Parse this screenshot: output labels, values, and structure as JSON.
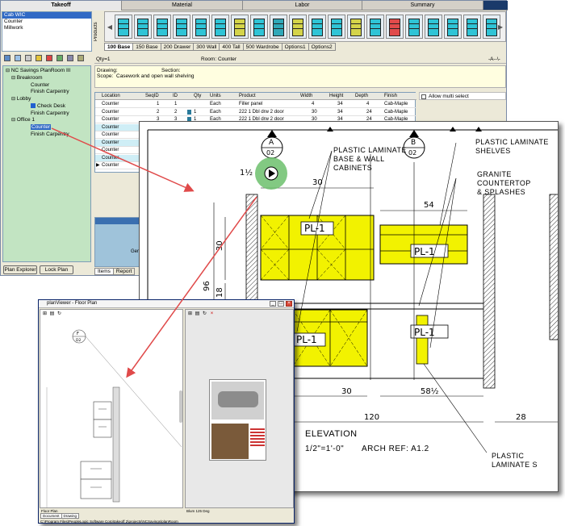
{
  "main": {
    "tabs": [
      "Takeoff",
      "Material",
      "Labor",
      "Summary"
    ],
    "categories": [
      "Cab WIC",
      "Counter",
      "Millwork"
    ],
    "products_label": "Products",
    "sub_tabs": [
      "100 Base",
      "150 Base",
      "200 Drawer",
      "300 Wall",
      "400 Tall",
      "500 Wardrobe",
      "Options1",
      "Options2"
    ],
    "qty_label": "Qty=1",
    "room_label": "Room: Counter",
    "nav_arrows": "-A--\\-",
    "drawing_label": "Drawing:",
    "section_label": "Section:",
    "scope_label": "Scope:",
    "scope_value": "Casework and open  wall shelving",
    "tree": {
      "root": "NC Savings  PlanRoom III",
      "items": [
        {
          "label": "Breakroom",
          "level": 1
        },
        {
          "label": "Counter",
          "level": 2
        },
        {
          "label": "Finish Carpentry",
          "level": 2
        },
        {
          "label": "Lobby",
          "level": 1
        },
        {
          "label": "Check Desk",
          "level": 2
        },
        {
          "label": "Finish Carpentry",
          "level": 2
        },
        {
          "label": "Office 1",
          "level": 1
        },
        {
          "label": "Counter",
          "level": 2
        },
        {
          "label": "Finish Carpentry",
          "level": 2
        }
      ]
    },
    "plan_explorer_btn": "Plan Explorer",
    "lock_plan_btn": "Lock Plan",
    "grid": {
      "headers": [
        "Location",
        "SeqID",
        "ID",
        "Qty",
        "Units",
        "Product",
        "Width",
        "Height",
        "Depth",
        "Finish"
      ],
      "rows": [
        {
          "location": "Counter",
          "seq": "1",
          "id": "1",
          "qty": "",
          "units": "Each",
          "product": "Filler panel",
          "width": "4",
          "height": "34",
          "depth": "4",
          "finish": "Cab-Maple"
        },
        {
          "location": "Counter",
          "seq": "2",
          "id": "2",
          "qty": "1",
          "units": "Each",
          "product": "222 1 Dbl drw 2 door",
          "width": "30",
          "height": "34",
          "depth": "24",
          "finish": "Cab-Maple"
        },
        {
          "location": "Counter",
          "seq": "3",
          "id": "3",
          "qty": "1",
          "units": "Each",
          "product": "222 1 Dbl drw 2 door",
          "width": "30",
          "height": "34",
          "depth": "24",
          "finish": "Cab-Maple"
        },
        {
          "location": "Counter",
          "seq": "",
          "id": "",
          "qty": "",
          "units": "",
          "product": "",
          "width": "",
          "height": "",
          "depth": "",
          "finish": ""
        },
        {
          "location": "Counter",
          "seq": "",
          "id": "",
          "qty": "",
          "units": "",
          "product": "",
          "width": "",
          "height": "",
          "depth": "",
          "finish": ""
        },
        {
          "location": "Counter",
          "seq": "",
          "id": "",
          "qty": "",
          "units": "",
          "product": "",
          "width": "",
          "height": "",
          "depth": "",
          "finish": ""
        },
        {
          "location": "Counter",
          "seq": "",
          "id": "",
          "qty": "",
          "units": "",
          "product": "",
          "width": "",
          "height": "",
          "depth": "",
          "finish": ""
        },
        {
          "location": "Counter",
          "seq": "",
          "id": "",
          "qty": "",
          "units": "",
          "product": "",
          "width": "",
          "height": "",
          "depth": "",
          "finish": ""
        },
        {
          "location": "Counter",
          "seq": "",
          "id": "",
          "qty": "",
          "units": "",
          "product": "",
          "width": "",
          "height": "",
          "depth": "",
          "finish": ""
        }
      ]
    },
    "allow_multi_select": "Allow multi select",
    "gen_label": "Gen",
    "items_tabs": [
      "Items",
      "Report"
    ]
  },
  "drawing": {
    "marker_a_letter": "A",
    "marker_a_num": "02",
    "marker_b_letter": "B",
    "marker_b_num": "02",
    "callout_base_wall": [
      "PLASTIC LAMINATE",
      "BASE & WALL",
      "CABINETS"
    ],
    "callout_shelves": [
      "PLASTIC LAMINATE",
      "SHELVES"
    ],
    "callout_granite": [
      "GRANITE COUNTERTOP",
      "& SPLASHES"
    ],
    "callout_bottom": "PLASTIC LAMINATE S",
    "dims": {
      "d30_top": "30",
      "d54": "54",
      "d1_half": "1½",
      "d96": "96",
      "d30_side": "30",
      "d18": "18",
      "d30_bottom": "30",
      "d58_half": "58½",
      "d120": "120",
      "d28": "28"
    },
    "pl_label": "PL-1",
    "elevation_title": "ELEVATION",
    "elevation_scale": "1/2\"=1'-0\"",
    "arch_ref": "ARCH REF:  A1.2"
  },
  "viewer": {
    "title": "planViewer - Floor Plan",
    "marker_letter": "F",
    "marker_num": "D2",
    "left_label": "Floor Plan",
    "right_label": "Blum 125 Deg",
    "tabs": [
      "Document",
      "Drawing"
    ],
    "status": "C:\\Program Files\\PeopleLogic Software Corp\\takeoff 2\\projects\\NCSavings\\planRoom"
  },
  "colors": {
    "highlight_yellow": "#f2f200",
    "tree_green": "#c2e4c2",
    "arrow_red": "#e04a4a",
    "selection_blue": "#316ac5",
    "play_green": "#6cbf6c"
  },
  "icons": {
    "play": "play-icon",
    "arrow_left": "arrow-left-icon",
    "arrow_right": "arrow-right-icon"
  }
}
